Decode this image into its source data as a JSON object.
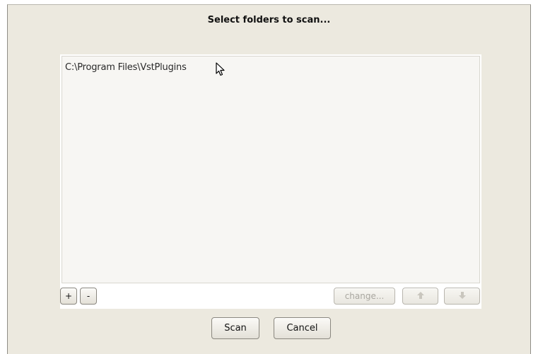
{
  "dialog": {
    "title": "Select folders to scan...",
    "folders": [
      "C:\\Program Files\\VstPlugins"
    ],
    "controls": {
      "add_label": "+",
      "remove_label": "-",
      "change_label": "change...",
      "move_up_icon": "arrow-up-icon",
      "move_down_icon": "arrow-down-icon"
    },
    "buttons": {
      "scan_label": "Scan",
      "cancel_label": "Cancel"
    }
  }
}
